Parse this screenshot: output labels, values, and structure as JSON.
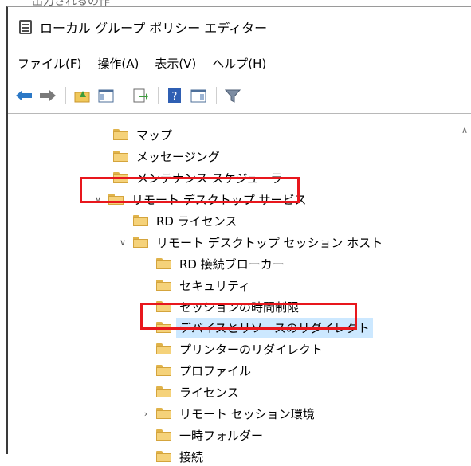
{
  "top_strip_text": "出力されるの作",
  "window": {
    "title": "ローカル グループ ポリシー エディター"
  },
  "menu": [
    "ファイル(F)",
    "操作(A)",
    "表示(V)",
    "ヘルプ(H)"
  ],
  "toolbar": {
    "icons": [
      "back-arrow-icon",
      "forward-arrow-icon",
      "up-folder-icon",
      "show-hide-tree-icon",
      "export-list-icon",
      "help-icon",
      "properties-view-icon",
      "filter-icon"
    ]
  },
  "tree": {
    "items": [
      {
        "label": "マップ"
      },
      {
        "label": "メッセージング"
      },
      {
        "label": "メンテナンス スケジューラ"
      },
      {
        "label": "リモート デスクトップ サービス",
        "expanded": true
      },
      {
        "label": "RD ライセンス"
      },
      {
        "label": "リモート デスクトップ セッション ホスト",
        "expanded": true
      },
      {
        "label": "RD 接続ブローカー"
      },
      {
        "label": "セキュリティ"
      },
      {
        "label": "セッションの時間制限"
      },
      {
        "label": "デバイスとリソースのリダイレクト",
        "selected": true
      },
      {
        "label": "プリンターのリダイレクト"
      },
      {
        "label": "プロファイル"
      },
      {
        "label": "ライセンス"
      },
      {
        "label": "リモート セッション環境",
        "collapsed": true
      },
      {
        "label": "一時フォルダー"
      },
      {
        "label": "接続"
      }
    ]
  },
  "colors": {
    "highlight_box": "#e8171d",
    "selection": "#cce8ff",
    "folder": "#f5d27a"
  }
}
